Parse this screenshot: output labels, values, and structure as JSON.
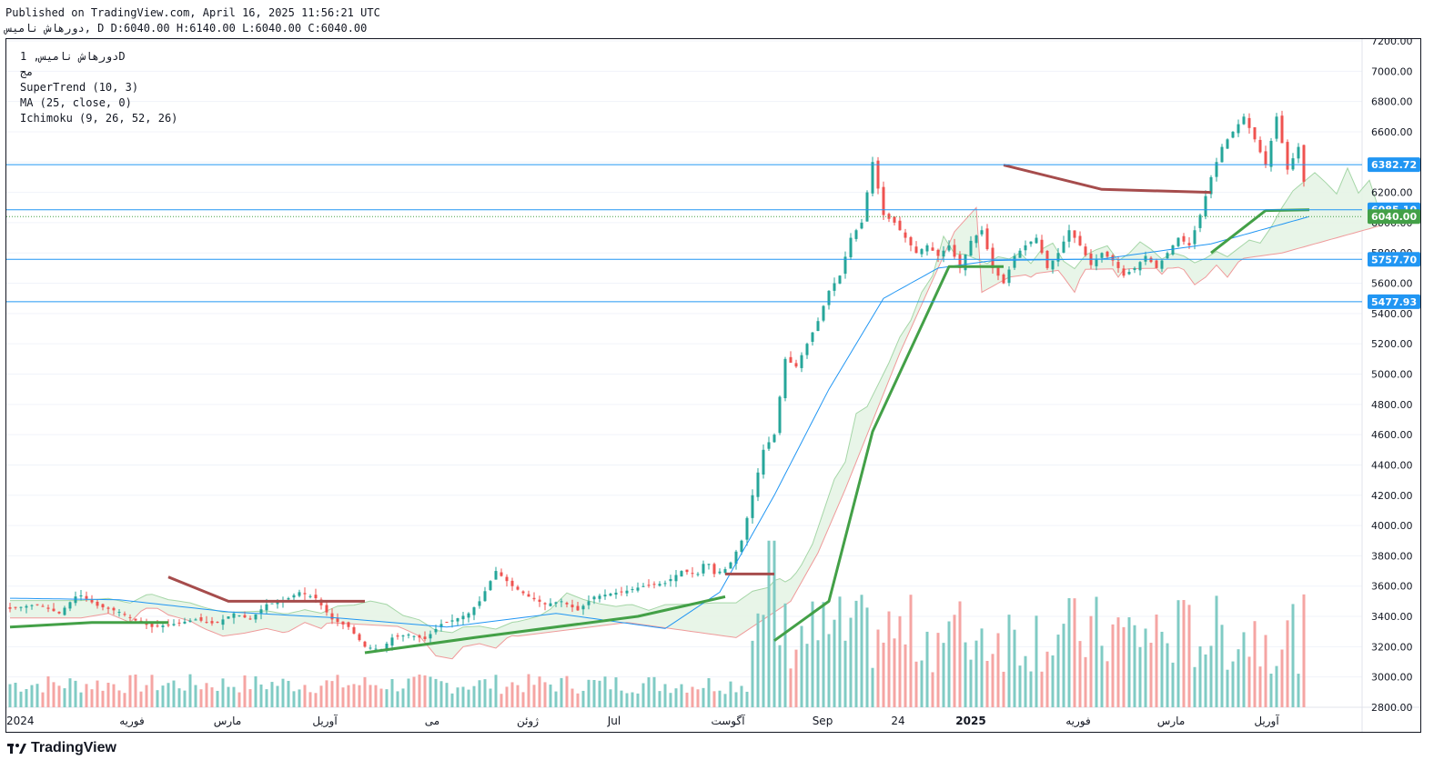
{
  "header": {
    "published": "Published on TradingView.com, April 16, 2025 11:56:21 UTC",
    "ohlc": "دورهاش نامیس, D D:6040.00 H:6140.00 L:6040.00 C:6040.00"
  },
  "legend": {
    "symbol": "دورهاش نامیس, 1D",
    "sub": "مج",
    "supertrend": "SuperTrend (10, 3)",
    "ma": "MA (25, close, 0)",
    "ichimoku": "Ichimoku (9, 26, 52, 26)"
  },
  "footer": {
    "brand": "TradingView"
  },
  "colors": {
    "up": "#26a69a",
    "down": "#ef5350",
    "supertrend_up": "#43a047",
    "supertrend_down": "#a64c4c",
    "ma": "#2196f3",
    "hline": "#2196f3",
    "cloud_bull": "#e6f4e6",
    "cloud_bear": "#fbe4e4"
  },
  "chart_data": {
    "type": "candlestick",
    "y_axis": {
      "min": 2800,
      "max": 7200,
      "ticks": [
        2800,
        3000,
        3200,
        3400,
        3600,
        3800,
        4000,
        4200,
        4400,
        4600,
        4800,
        5000,
        5200,
        5400,
        5600,
        5800,
        6000,
        6200,
        6400,
        6600,
        6800,
        7000,
        7200
      ],
      "tick_labels": [
        "2800.00",
        "3000.00",
        "3200.00",
        "3400.00",
        "3600.00",
        "3800.00",
        "4000.00",
        "4200.00",
        "4400.00",
        "4600.00",
        "4800.00",
        "5000.00",
        "5200.00",
        "5400.00",
        "5600.00",
        "5800.00",
        "6000.00",
        "6200.00",
        "6400.00",
        "6600.00",
        "6800.00",
        "7000.00",
        "7200.00"
      ]
    },
    "x_axis_labels": [
      "2024",
      "فوریه",
      "مارس",
      "آوریل",
      "می",
      "ژوئن",
      "Jul",
      "آگوست",
      "Sep",
      "24",
      "2025",
      "فوریه",
      "مارس",
      "آوریل"
    ],
    "horizontal_levels": [
      {
        "value": 6382.72,
        "label": "6382.72"
      },
      {
        "value": 6085.1,
        "label": "6085.10"
      },
      {
        "value": 5757.7,
        "label": "5757.70"
      },
      {
        "value": 5477.93,
        "label": "5477.93"
      }
    ],
    "last_price": {
      "value": 6040.0,
      "label": "6040.00"
    },
    "price_path": [
      [
        0,
        3450
      ],
      [
        10,
        3480
      ],
      [
        18,
        3420
      ],
      [
        25,
        3550
      ],
      [
        32,
        3470
      ],
      [
        40,
        3430
      ],
      [
        45,
        3380
      ],
      [
        52,
        3330
      ],
      [
        60,
        3350
      ],
      [
        68,
        3380
      ],
      [
        75,
        3350
      ],
      [
        82,
        3420
      ],
      [
        88,
        3380
      ],
      [
        94,
        3480
      ],
      [
        100,
        3500
      ],
      [
        106,
        3560
      ],
      [
        112,
        3520
      ],
      [
        118,
        3380
      ],
      [
        124,
        3330
      ],
      [
        130,
        3200
      ],
      [
        136,
        3180
      ],
      [
        140,
        3260
      ],
      [
        146,
        3280
      ],
      [
        152,
        3250
      ],
      [
        158,
        3350
      ],
      [
        163,
        3380
      ],
      [
        168,
        3420
      ],
      [
        172,
        3500
      ],
      [
        178,
        3700
      ],
      [
        184,
        3600
      ],
      [
        190,
        3530
      ],
      [
        196,
        3480
      ],
      [
        202,
        3500
      ],
      [
        208,
        3440
      ],
      [
        214,
        3530
      ],
      [
        220,
        3550
      ],
      [
        226,
        3570
      ],
      [
        232,
        3600
      ],
      [
        240,
        3620
      ],
      [
        246,
        3700
      ],
      [
        252,
        3680
      ],
      [
        255,
        3780
      ],
      [
        258,
        3680
      ],
      [
        263,
        3720
      ],
      [
        268,
        3900
      ],
      [
        272,
        4200
      ],
      [
        276,
        4500
      ],
      [
        280,
        4600
      ],
      [
        284,
        5100
      ],
      [
        288,
        5050
      ],
      [
        292,
        5200
      ],
      [
        296,
        5350
      ],
      [
        300,
        5550
      ],
      [
        304,
        5650
      ],
      [
        308,
        5900
      ],
      [
        312,
        6000
      ],
      [
        316,
        6400
      ],
      [
        320,
        6050
      ],
      [
        324,
        6000
      ],
      [
        328,
        5900
      ],
      [
        332,
        5800
      ],
      [
        336,
        5850
      ],
      [
        340,
        5780
      ],
      [
        344,
        5850
      ],
      [
        348,
        5700
      ],
      [
        352,
        5880
      ],
      [
        356,
        5950
      ],
      [
        360,
        5700
      ],
      [
        364,
        5600
      ],
      [
        368,
        5780
      ],
      [
        372,
        5850
      ],
      [
        376,
        5900
      ],
      [
        380,
        5700
      ],
      [
        384,
        5800
      ],
      [
        388,
        5950
      ],
      [
        392,
        5850
      ],
      [
        396,
        5720
      ],
      [
        400,
        5800
      ],
      [
        404,
        5750
      ],
      [
        408,
        5650
      ],
      [
        412,
        5700
      ],
      [
        416,
        5780
      ],
      [
        420,
        5700
      ],
      [
        424,
        5800
      ],
      [
        428,
        5900
      ],
      [
        432,
        5850
      ],
      [
        436,
        6050
      ],
      [
        440,
        6300
      ],
      [
        444,
        6500
      ],
      [
        448,
        6600
      ],
      [
        452,
        6700
      ],
      [
        456,
        6550
      ],
      [
        460,
        6380
      ],
      [
        464,
        6700
      ],
      [
        468,
        6350
      ],
      [
        472,
        6500
      ],
      [
        476,
        6040
      ]
    ],
    "ma_path": [
      [
        0,
        3520
      ],
      [
        40,
        3510
      ],
      [
        80,
        3430
      ],
      [
        120,
        3390
      ],
      [
        160,
        3330
      ],
      [
        200,
        3420
      ],
      [
        240,
        3320
      ],
      [
        260,
        3560
      ],
      [
        280,
        4200
      ],
      [
        300,
        4900
      ],
      [
        320,
        5500
      ],
      [
        340,
        5700
      ],
      [
        360,
        5750
      ],
      [
        400,
        5760
      ],
      [
        440,
        5860
      ],
      [
        476,
        6040
      ]
    ],
    "supertrend_segments": [
      {
        "dir": "up",
        "points": [
          [
            0,
            3330
          ],
          [
            30,
            3360
          ],
          [
            58,
            3360
          ]
        ]
      },
      {
        "dir": "down",
        "points": [
          [
            58,
            3660
          ],
          [
            80,
            3500
          ],
          [
            130,
            3500
          ]
        ]
      },
      {
        "dir": "up",
        "points": [
          [
            130,
            3160
          ],
          [
            170,
            3260
          ],
          [
            230,
            3400
          ],
          [
            262,
            3530
          ]
        ]
      },
      {
        "dir": "down",
        "points": [
          [
            262,
            3680
          ],
          [
            280,
            3680
          ]
        ]
      },
      {
        "dir": "up",
        "points": [
          [
            280,
            3240
          ],
          [
            300,
            3500
          ],
          [
            316,
            4620
          ],
          [
            344,
            5710
          ],
          [
            364,
            5710
          ]
        ]
      },
      {
        "dir": "down",
        "points": [
          [
            364,
            6380
          ],
          [
            400,
            6220
          ],
          [
            440,
            6200
          ]
        ]
      },
      {
        "dir": "up",
        "points": [
          [
            440,
            5800
          ],
          [
            460,
            6080
          ],
          [
            476,
            6085
          ]
        ]
      }
    ],
    "volume_max_share": 0.25
  }
}
